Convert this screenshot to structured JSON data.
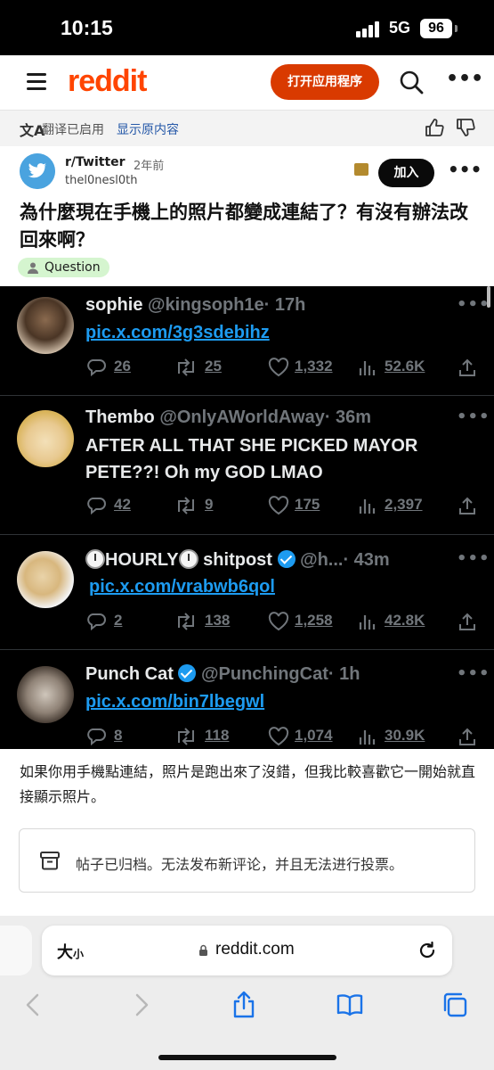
{
  "status_bar": {
    "time": "10:15",
    "network": "5G",
    "battery": "96"
  },
  "header": {
    "logo": "reddit",
    "open_app_label": "打开应用程序",
    "icons": [
      "menu-icon",
      "search-icon",
      "more-icon"
    ]
  },
  "translate_bar": {
    "status": "翻译已启用",
    "show_original": "显示原内容",
    "icons": [
      "translate-icon",
      "thumbs-up-icon",
      "thumbs-down-icon"
    ]
  },
  "post": {
    "subreddit": "r/Twitter",
    "age": "2年前",
    "author": "thel0nesl0th",
    "join_label": "加入",
    "title": "為什麼現在手機上的照片都變成連結了？有沒有辦法改回來啊？",
    "flair": "Question",
    "body": "如果你用手機點連結，照片是跑出來了沒錯，但我比較喜歡它一開始就直接顯示照片。",
    "archived_notice": "帖子已归档。无法发布新评论，并且无法进行投票。"
  },
  "tweets": [
    {
      "name": "sophie",
      "handle": "@kingsoph1e",
      "time": "· 17h",
      "link": "pic.x.com/3g3sdebihz",
      "text": "",
      "replies": "26",
      "retweets": "25",
      "likes": "1,332",
      "views": "52.6K"
    },
    {
      "name": "Thembo",
      "handle": "@OnlyAWorldAway",
      "time": "· 36m",
      "link": "",
      "text": "AFTER ALL THAT SHE PICKED MAYOR PETE??! Oh my GOD LMAO",
      "replies": "42",
      "retweets": "9",
      "likes": "175",
      "views": "2,397"
    },
    {
      "name": "HOURLY",
      "name_suffix": "shitpost",
      "handle": "@h...",
      "time": "· 43m",
      "link": "pic.x.com/vrabwb6qol",
      "text": "",
      "replies": "2",
      "retweets": "138",
      "likes": "1,258",
      "views": "42.8K"
    },
    {
      "name": "Punch Cat",
      "handle": "@PunchingCat",
      "time": "· 1h",
      "link": "pic.x.com/bin7lbegwl",
      "text": "",
      "replies": "8",
      "retweets": "118",
      "likes": "1,074",
      "views": "30.9K"
    }
  ],
  "browser": {
    "text_size": "大",
    "text_size_small": "小",
    "url": "reddit.com"
  },
  "colors": {
    "reddit_orange": "#ff4500",
    "open_app_bg": "#d93a00",
    "twitter_blue": "#1d9bf0",
    "flair_bg": "#d5f5cf"
  }
}
